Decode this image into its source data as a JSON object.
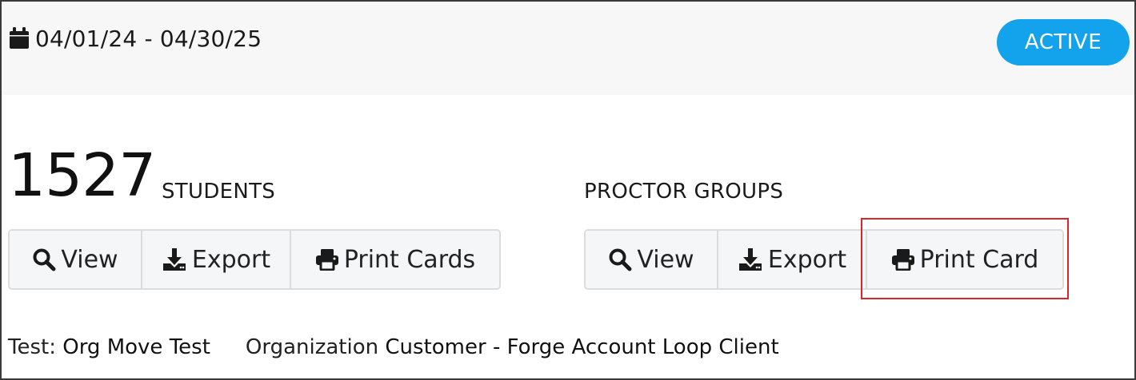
{
  "header": {
    "date_range": "04/01/24 - 04/30/25",
    "status": "ACTIVE",
    "calendar_icon": "calendar-icon",
    "status_color": "#13a3ec"
  },
  "students": {
    "count": "1527",
    "label": "STUDENTS",
    "buttons": {
      "view": "View",
      "export": "Export",
      "print": "Print Cards"
    }
  },
  "proctor_groups": {
    "label": "PROCTOR GROUPS",
    "buttons": {
      "view": "View",
      "export": "Export",
      "print": "Print Card"
    }
  },
  "info": {
    "test_key": "Test:",
    "test_value": "Org Move Test",
    "org_key": "Organization",
    "org_value": "Customer - Forge Account Loop Client"
  },
  "icons": {
    "view": "search-icon",
    "export": "download-icon",
    "print": "printer-icon"
  },
  "highlight_color": "#d9262c"
}
